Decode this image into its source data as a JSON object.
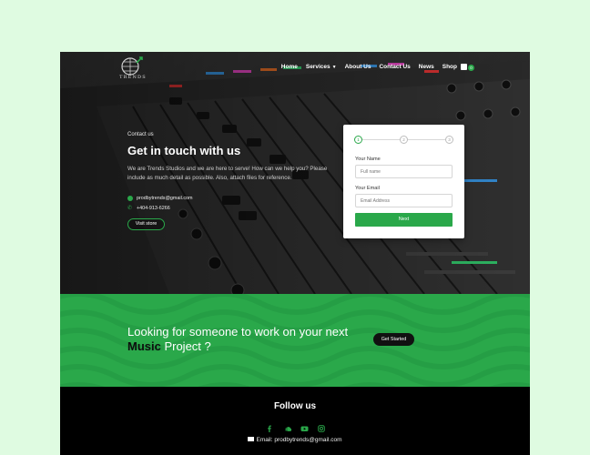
{
  "nav": {
    "logo_text": "TRENDS",
    "items": [
      {
        "label": "Home"
      },
      {
        "label": "Services",
        "caret": "▼"
      },
      {
        "label": "About Us"
      },
      {
        "label": "Contact Us"
      },
      {
        "label": "News"
      },
      {
        "label": "Shop"
      }
    ],
    "cart_count": "0"
  },
  "hero": {
    "eyebrow": "Contact us",
    "title": "Get in touch with us",
    "description": "We are Trends Studios and we are here to serve! How can we help you? Please include as much detail as possible. Also, attach files for reference.",
    "email": "prodbytrends@gmail.com",
    "phone": "+404-913-6266",
    "visit_button": "Visit store"
  },
  "form": {
    "steps": [
      "1",
      "2",
      "3"
    ],
    "name_label": "Your Name",
    "name_placeholder": "Full name",
    "email_label": "Your Email",
    "email_placeholder": "Email Address",
    "next_label": "Next"
  },
  "cta": {
    "line1": "Looking for someone to work on your next",
    "highlight": "Music",
    "line2_rest": " Project ?",
    "button": "Get Started"
  },
  "footer": {
    "title": "Follow us",
    "socials": [
      "facebook-icon",
      "soundcloud-icon",
      "youtube-icon",
      "instagram-icon"
    ],
    "email_label": "Email: prodbytrends@gmail.com"
  },
  "colors": {
    "accent": "#2aa84a",
    "background": "#dffbe1",
    "footer": "#000000"
  }
}
